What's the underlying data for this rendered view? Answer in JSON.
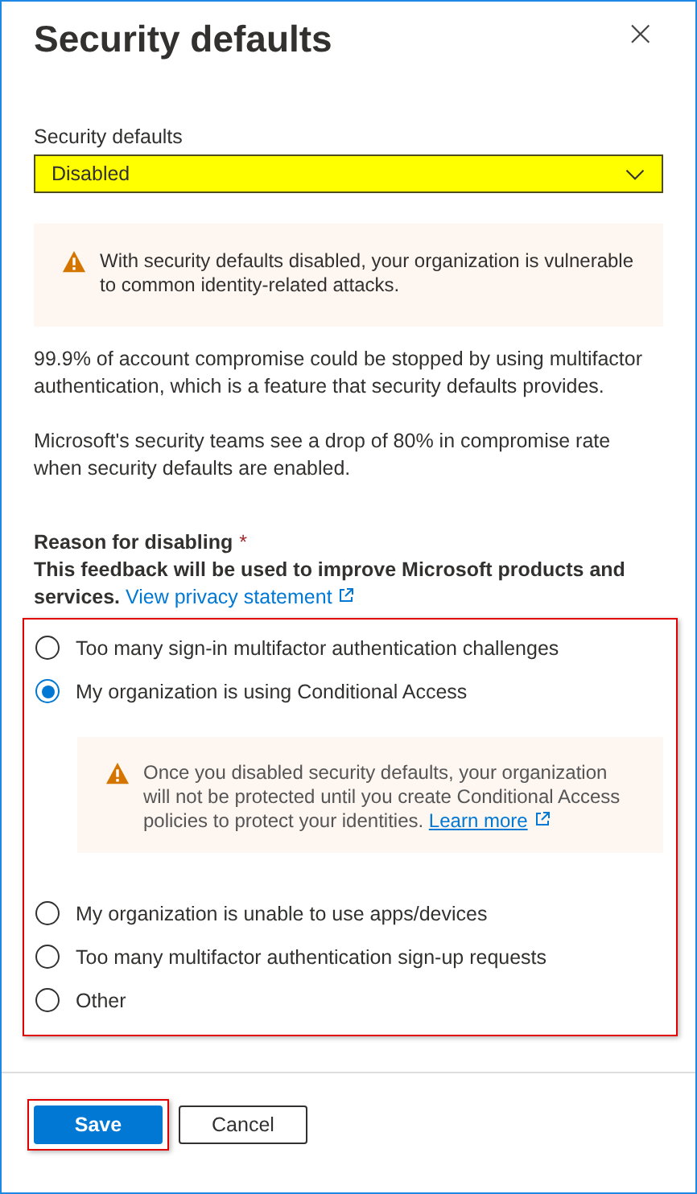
{
  "panel": {
    "title": "Security defaults",
    "close": "×"
  },
  "dropdown": {
    "label": "Security defaults",
    "value": "Disabled",
    "highlighted": true
  },
  "warning": "With security defaults disabled, your organization is vulnerable to common identity-related attacks.",
  "paragraphs": [
    "99.9% of account compromise could be stopped by using multifactor authentication, which is a feature that security defaults provides.",
    "Microsoft's security teams see a drop of 80% in compromise rate when security defaults are enabled."
  ],
  "reason": {
    "heading": "Reason for disabling",
    "required": "*",
    "description": "This feedback will be used to improve Microsoft products and services.",
    "link": "View privacy statement",
    "highlighted": true
  },
  "options": [
    {
      "label": "Too many sign-in multifactor authentication challenges",
      "selected": false
    },
    {
      "label": "My organization is using Conditional Access",
      "selected": true,
      "note": "Once you disabled security defaults, your organization will not be protected until you create Conditional Access policies to protect your identities.",
      "note_link": "Learn more"
    },
    {
      "label": "My organization is unable to use apps/devices",
      "selected": false
    },
    {
      "label": "Too many multifactor authentication sign-up requests",
      "selected": false
    },
    {
      "label": "Other",
      "selected": false
    }
  ],
  "buttons": [
    {
      "label": "Save",
      "kind": "primary",
      "highlighted": true
    },
    {
      "label": "Cancel",
      "kind": "secondary",
      "highlighted": false
    }
  ]
}
